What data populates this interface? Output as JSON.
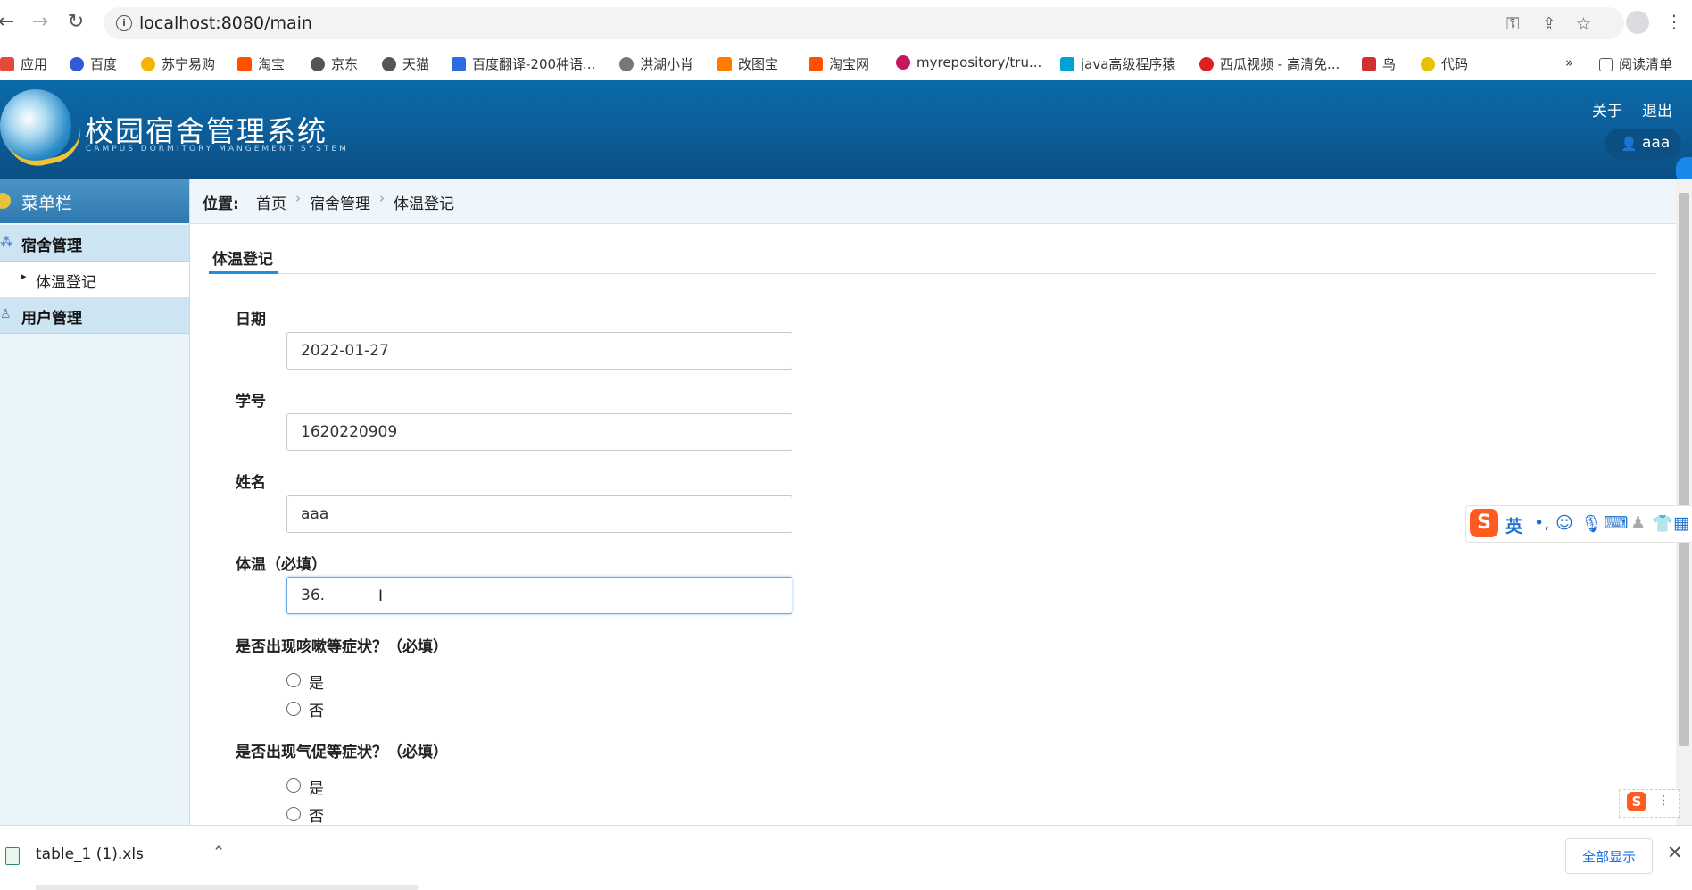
{
  "browser": {
    "url": "localhost:8080/main",
    "bookmarks": [
      {
        "label": "应用",
        "color": "#e24a3b"
      },
      {
        "label": "百度",
        "color": "#2f5bd8"
      },
      {
        "label": "苏宁易购",
        "color": "#f5b400"
      },
      {
        "label": "淘宝",
        "color": "#ff5000"
      },
      {
        "label": "京东",
        "color": "#555555"
      },
      {
        "label": "天猫",
        "color": "#555555"
      },
      {
        "label": "百度翻译-200种语...",
        "color": "#2b6de0"
      },
      {
        "label": "洪湖小肖",
        "color": "#777777"
      },
      {
        "label": "改图宝",
        "color": "#ff7a00"
      },
      {
        "label": "淘宝网",
        "color": "#ff5000"
      },
      {
        "label": "myrepository/tru...",
        "color": "#c2185b"
      },
      {
        "label": "java高级程序猿",
        "color": "#00a1d6"
      },
      {
        "label": "西瓜视频 - 高清免...",
        "color": "#e02020"
      },
      {
        "label": "鸟",
        "color": "#d23030"
      },
      {
        "label": "代码",
        "color": "#e6c200"
      }
    ],
    "more": "»",
    "reading_list": "阅读清单"
  },
  "header": {
    "title": "校园宿舍管理系统",
    "subtitle": "CAMPUS DORMITORY MANGEMENT SYSTEM",
    "about": "关于",
    "logout": "退出",
    "username": "aaa"
  },
  "sidebar": {
    "title": "菜单栏",
    "sections": [
      {
        "label": "宿舍管理",
        "items": [
          "体温登记"
        ]
      },
      {
        "label": "用户管理",
        "items": []
      }
    ]
  },
  "breadcrumb": {
    "prefix": "位置:",
    "items": [
      "首页",
      "宿舍管理",
      "体温登记"
    ],
    "separator": "›"
  },
  "form": {
    "tab": "体温登记",
    "fields": [
      {
        "label": "日期",
        "value": "2022-01-27"
      },
      {
        "label": "学号",
        "value": "1620220909"
      },
      {
        "label": "姓名",
        "value": "aaa"
      },
      {
        "label": "体温（必填）",
        "value": "36."
      }
    ],
    "questions": [
      {
        "label": "是否出现咳嗽等症状？（必填）",
        "options": [
          "是",
          "否"
        ]
      },
      {
        "label": "是否出现气促等症状？（必填）",
        "options": [
          "是",
          "否"
        ]
      }
    ]
  },
  "ime": {
    "mode": "英"
  },
  "download": {
    "filename": "table_1 (1).xls",
    "show_all": "全部显示"
  },
  "colors": {
    "header": "#0c5d98",
    "sidebar_bg": "#e8f3fa",
    "accent": "#1f8ee0"
  }
}
